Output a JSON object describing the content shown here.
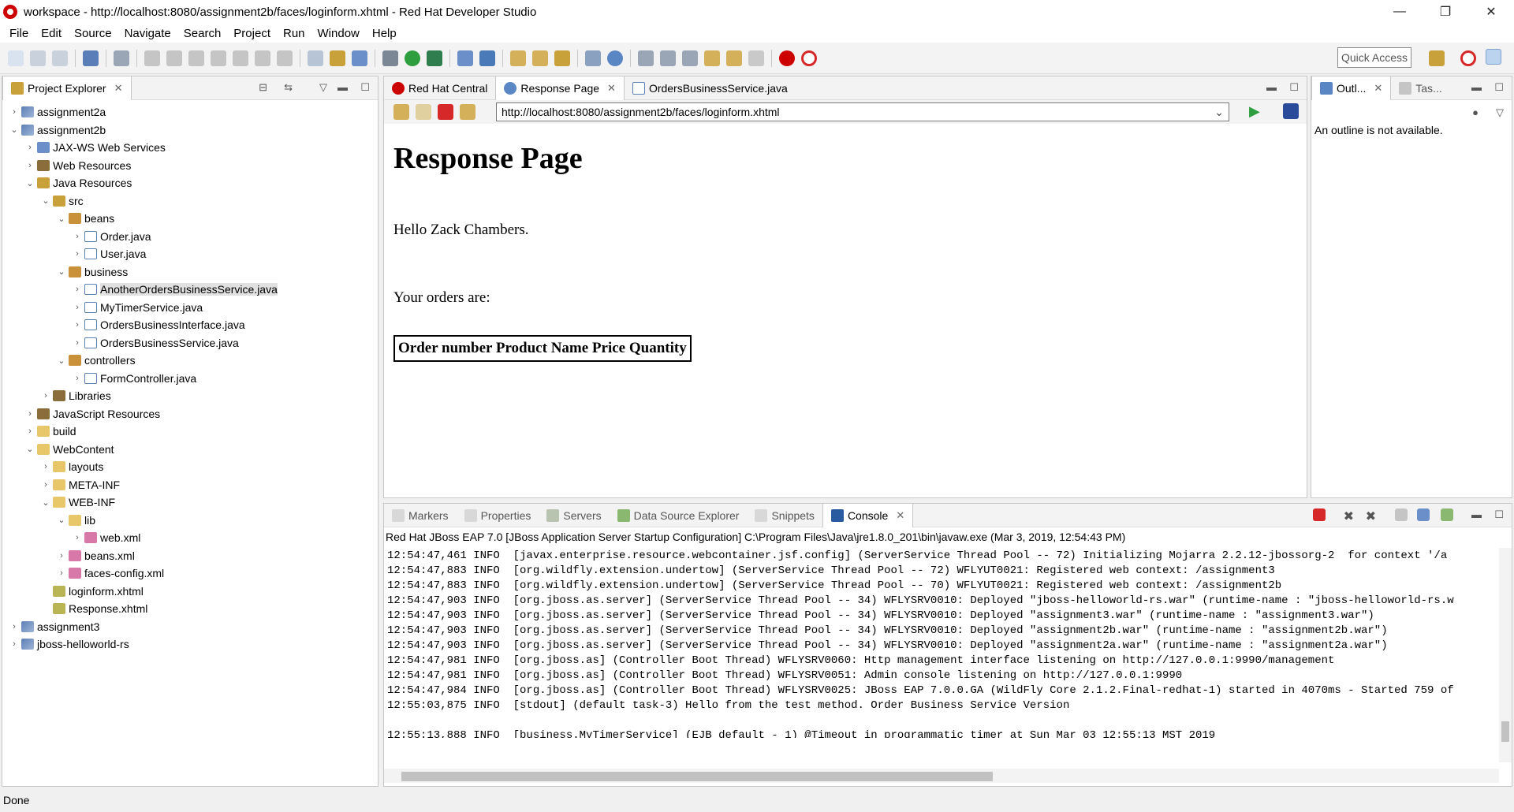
{
  "window": {
    "title": "workspace - http://localhost:8080/assignment2b/faces/loginform.xhtml - Red Hat Developer Studio",
    "controls": [
      "—",
      "❐",
      "✕"
    ]
  },
  "menu": [
    "File",
    "Edit",
    "Source",
    "Navigate",
    "Search",
    "Project",
    "Run",
    "Window",
    "Help"
  ],
  "quick_access": "Quick Access",
  "project_explorer": {
    "tab_label": "Project Explorer",
    "items": [
      {
        "label": "assignment2a",
        "icon": "project-icon",
        "depth": 0,
        "arrow": "›"
      },
      {
        "label": "assignment2b",
        "icon": "project-icon",
        "depth": 0,
        "arrow": "⌄"
      },
      {
        "label": "JAX-WS Web Services",
        "icon": "webservices-icon",
        "depth": 1,
        "arrow": "›"
      },
      {
        "label": "Web Resources",
        "icon": "webresources-icon",
        "depth": 1,
        "arrow": "›"
      },
      {
        "label": "Java Resources",
        "icon": "javaresources-icon",
        "depth": 1,
        "arrow": "⌄"
      },
      {
        "label": "src",
        "icon": "source-folder-icon",
        "depth": 2,
        "arrow": "⌄"
      },
      {
        "label": "beans",
        "icon": "package-icon",
        "depth": 3,
        "arrow": "⌄"
      },
      {
        "label": "Order.java",
        "icon": "java-file-icon",
        "depth": 4,
        "arrow": "›"
      },
      {
        "label": "User.java",
        "icon": "java-file-icon",
        "depth": 4,
        "arrow": "›"
      },
      {
        "label": "business",
        "icon": "package-icon",
        "depth": 3,
        "arrow": "⌄"
      },
      {
        "label": "AnotherOrdersBusinessService.java",
        "icon": "java-file-icon",
        "depth": 4,
        "arrow": "›",
        "selected": true
      },
      {
        "label": "MyTimerService.java",
        "icon": "java-file-icon",
        "depth": 4,
        "arrow": "›"
      },
      {
        "label": "OrdersBusinessInterface.java",
        "icon": "java-interface-icon",
        "depth": 4,
        "arrow": "›"
      },
      {
        "label": "OrdersBusinessService.java",
        "icon": "java-file-icon",
        "depth": 4,
        "arrow": "›"
      },
      {
        "label": "controllers",
        "icon": "package-icon",
        "depth": 3,
        "arrow": "⌄"
      },
      {
        "label": "FormController.java",
        "icon": "java-file-icon",
        "depth": 4,
        "arrow": "›"
      },
      {
        "label": "Libraries",
        "icon": "libraries-icon",
        "depth": 2,
        "arrow": "›"
      },
      {
        "label": "JavaScript Resources",
        "icon": "js-resources-icon",
        "depth": 1,
        "arrow": "›"
      },
      {
        "label": "build",
        "icon": "folder-icon",
        "depth": 1,
        "arrow": "›"
      },
      {
        "label": "WebContent",
        "icon": "folder-icon",
        "depth": 1,
        "arrow": "⌄"
      },
      {
        "label": "layouts",
        "icon": "folder-icon",
        "depth": 2,
        "arrow": "›"
      },
      {
        "label": "META-INF",
        "icon": "folder-icon",
        "depth": 2,
        "arrow": "›"
      },
      {
        "label": "WEB-INF",
        "icon": "folder-icon",
        "depth": 2,
        "arrow": "⌄"
      },
      {
        "label": "lib",
        "icon": "folder-icon",
        "depth": 3,
        "arrow": "⌄"
      },
      {
        "label": "web.xml",
        "icon": "xml-file-icon",
        "depth": 4,
        "arrow": "›"
      },
      {
        "label": "beans.xml",
        "icon": "xml-file-icon",
        "depth": 3,
        "arrow": "›"
      },
      {
        "label": "faces-config.xml",
        "icon": "xml-file-icon",
        "depth": 3,
        "arrow": "›"
      },
      {
        "label": "loginform.xhtml",
        "icon": "xhtml-file-icon",
        "depth": 2,
        "arrow": ""
      },
      {
        "label": "Response.xhtml",
        "icon": "xhtml-file-icon",
        "depth": 2,
        "arrow": ""
      },
      {
        "label": "assignment3",
        "icon": "project-icon",
        "depth": 0,
        "arrow": "›"
      },
      {
        "label": "jboss-helloworld-rs",
        "icon": "jboss-project-icon",
        "depth": 0,
        "arrow": "›"
      }
    ]
  },
  "editor": {
    "tabs": [
      {
        "label": "Red Hat Central",
        "icon": "redhat-icon",
        "active": false
      },
      {
        "label": "Response Page",
        "icon": "globe-icon",
        "active": true
      },
      {
        "label": "OrdersBusinessService.java",
        "icon": "java-file-icon",
        "active": false
      }
    ],
    "url": "http://localhost:8080/assignment2b/faces/loginform.xhtml",
    "page": {
      "heading": "Response Page",
      "greeting": "Hello Zack Chambers.",
      "orders_label": "Your orders are:",
      "table_header": "Order number Product Name Price Quantity"
    }
  },
  "outline": {
    "tabs": [
      "Outl...",
      "Tas..."
    ],
    "message": "An outline is not available."
  },
  "bottom": {
    "tabs": [
      "Markers",
      "Properties",
      "Servers",
      "Data Source Explorer",
      "Snippets",
      "Console"
    ],
    "console_header": "Red Hat JBoss EAP 7.0 [JBoss Application Server Startup Configuration] C:\\Program Files\\Java\\jre1.8.0_201\\bin\\javaw.exe (Mar 3, 2019, 12:54:43 PM)",
    "lines": [
      "12:54:47,461 INFO  [javax.enterprise.resource.webcontainer.jsf.config] (ServerService Thread Pool -- 72) Initializing Mojarra 2.2.12-jbossorg-2  for context '/a",
      "12:54:47,883 INFO  [org.wildfly.extension.undertow] (ServerService Thread Pool -- 72) WFLYUT0021: Registered web context: /assignment3",
      "12:54:47,883 INFO  [org.wildfly.extension.undertow] (ServerService Thread Pool -- 70) WFLYUT0021: Registered web context: /assignment2b",
      "12:54:47,903 INFO  [org.jboss.as.server] (ServerService Thread Pool -- 34) WFLYSRV0010: Deployed \"jboss-helloworld-rs.war\" (runtime-name : \"jboss-helloworld-rs.w",
      "12:54:47,903 INFO  [org.jboss.as.server] (ServerService Thread Pool -- 34) WFLYSRV0010: Deployed \"assignment3.war\" (runtime-name : \"assignment3.war\")",
      "12:54:47,903 INFO  [org.jboss.as.server] (ServerService Thread Pool -- 34) WFLYSRV0010: Deployed \"assignment2b.war\" (runtime-name : \"assignment2b.war\")",
      "12:54:47,903 INFO  [org.jboss.as.server] (ServerService Thread Pool -- 34) WFLYSRV0010: Deployed \"assignment2a.war\" (runtime-name : \"assignment2a.war\")",
      "12:54:47,981 INFO  [org.jboss.as] (Controller Boot Thread) WFLYSRV0060: Http management interface listening on http://127.0.0.1:9990/management",
      "12:54:47,981 INFO  [org.jboss.as] (Controller Boot Thread) WFLYSRV0051: Admin console listening on http://127.0.0.1:9990",
      "12:54:47,984 INFO  [org.jboss.as] (Controller Boot Thread) WFLYSRV0025: JBoss EAP 7.0.0.GA (WildFly Core 2.1.2.Final-redhat-1) started in 4070ms - Started 759 of",
      "12:55:03,875 INFO  [stdout] (default task-3) Hello from the test method. Order Business Service Version",
      "",
      "12:55:13,888 INFO  [business.MyTimerService] (EJB default - 1) @Timeout in programmatic timer at Sun Mar 03 12:55:13 MST 2019"
    ]
  },
  "status": "Done"
}
